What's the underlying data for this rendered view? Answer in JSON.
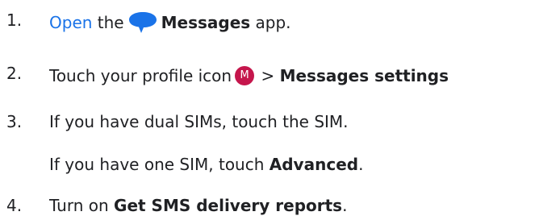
{
  "steps": [
    {
      "num": "1.",
      "link": "Open",
      "pre": " the",
      "bold": "Messages",
      "post": " app."
    },
    {
      "num": "2.",
      "pre": "Touch your profile icon",
      "avatar_letter": "M",
      "mid": " > ",
      "bold": "Messages settings"
    },
    {
      "num": "3.",
      "line1": "If you have dual SIMs, touch the SIM.",
      "line2_pre": "If you have one SIM, touch ",
      "line2_bold": "Advanced",
      "line2_post": "."
    },
    {
      "num": "4.",
      "pre": "Turn on ",
      "bold": "Get SMS delivery reports",
      "post": "."
    }
  ],
  "icons": {
    "messages": "messages-app-icon",
    "avatar": "profile-avatar-icon"
  },
  "colors": {
    "link": "#1a73e8",
    "messages_icon": "#1a73e8",
    "avatar": "#c5164c",
    "text": "#202124"
  }
}
